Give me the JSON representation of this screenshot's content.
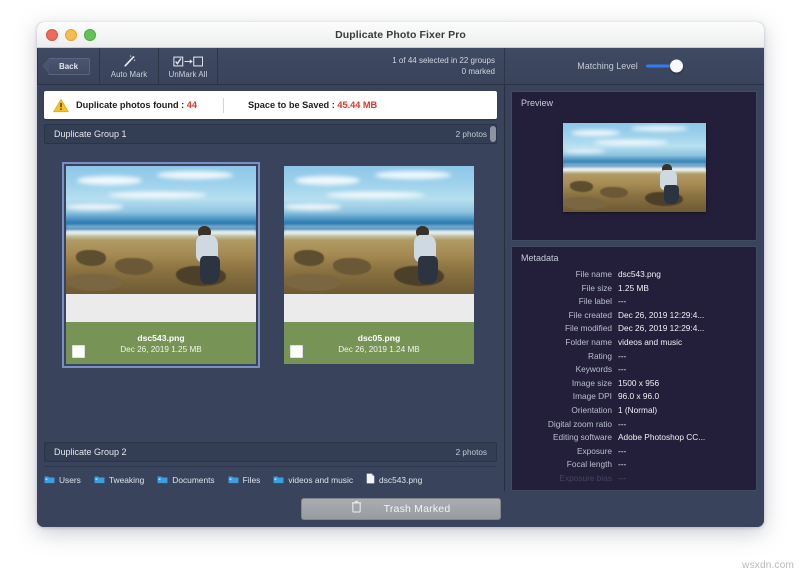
{
  "window": {
    "title": "Duplicate Photo Fixer Pro",
    "traffic_lights": [
      "close-red",
      "minimize-yellow",
      "zoom-green"
    ]
  },
  "toolbar": {
    "back_label": "Back",
    "auto_mark_label": "Auto Mark",
    "auto_mark_icon": "magic-wand-icon",
    "unmark_all_label": "UnMark All",
    "unmark_all_icon": "checkbox-to-empty-icon",
    "selection_status": "1 of 44 selected in 22 groups",
    "marked_status": "0 marked",
    "matching_level_label": "Matching Level",
    "matching_level_value": 78,
    "slider_accent": "#2f7ef0"
  },
  "summary": {
    "warning_icon": "warning-triangle-icon",
    "found_label": "Duplicate photos found : ",
    "found_value": "44",
    "saved_label": "Space to be Saved : ",
    "saved_value": "45.44 MB",
    "accent": "#d9372b"
  },
  "groups": [
    {
      "title": "Duplicate Group 1",
      "count": "2 photos",
      "photos": [
        {
          "name": "dsc543.png",
          "meta": "Dec 26, 2019 1.25 MB",
          "selected": true,
          "checked": false
        },
        {
          "name": "dsc05.png",
          "meta": "Dec 26, 2019 1.24 MB",
          "selected": false,
          "checked": false
        }
      ]
    },
    {
      "title": "Duplicate Group 2",
      "count": "2 photos"
    }
  ],
  "breadcrumb": [
    {
      "label": "Users",
      "icon": "folder-icon"
    },
    {
      "label": "Tweaking",
      "icon": "folder-icon"
    },
    {
      "label": "Documents",
      "icon": "folder-icon"
    },
    {
      "label": "Files",
      "icon": "folder-icon"
    },
    {
      "label": "videos and music",
      "icon": "folder-icon"
    },
    {
      "label": "dsc543.png",
      "icon": "file-icon"
    }
  ],
  "trash_button": {
    "label": "Trash Marked",
    "icon": "trash-icon"
  },
  "preview": {
    "title": "Preview",
    "image_alt": "beach-coastline-photo"
  },
  "metadata": {
    "title": "Metadata",
    "rows": [
      {
        "key": "File name",
        "value": "dsc543.png"
      },
      {
        "key": "File size",
        "value": "1.25 MB"
      },
      {
        "key": "File label",
        "value": "---"
      },
      {
        "key": "File created",
        "value": "Dec 26, 2019 12:29:4..."
      },
      {
        "key": "File modified",
        "value": "Dec 26, 2019 12:29:4..."
      },
      {
        "key": "Folder name",
        "value": "videos and music"
      },
      {
        "key": "Rating",
        "value": "---"
      },
      {
        "key": "Keywords",
        "value": "---"
      },
      {
        "key": "Image size",
        "value": "1500 x 956"
      },
      {
        "key": "Image DPI",
        "value": "96.0 x 96.0"
      },
      {
        "key": "Orientation",
        "value": "1 (Normal)"
      },
      {
        "key": "Digital zoom ratio",
        "value": "---"
      },
      {
        "key": "Editing software",
        "value": "Adobe Photoshop CC..."
      },
      {
        "key": "Exposure",
        "value": "---"
      },
      {
        "key": "Focal length",
        "value": "---"
      },
      {
        "key": "Exposure bias",
        "value": "---"
      }
    ]
  },
  "watermark": "wsxdn.com"
}
